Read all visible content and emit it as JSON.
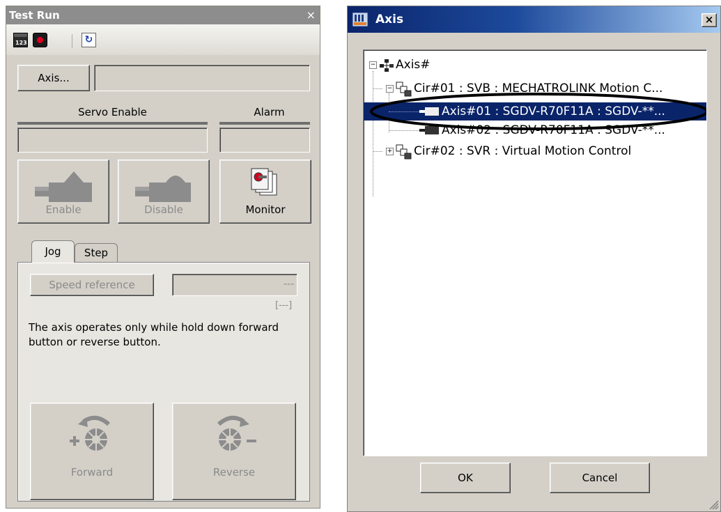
{
  "test_run": {
    "title": "Test Run",
    "close_glyph": "×",
    "toolbar": {
      "calendar_icon_text": "123",
      "icons": [
        "calendar-icon",
        "record-icon",
        "refresh-icon"
      ]
    },
    "axis_button_label": "Axis...",
    "axis_value": "",
    "servo_enable_label": "Servo Enable",
    "alarm_label": "Alarm",
    "enable_label": "Enable",
    "disable_label": "Disable",
    "monitor_label": "Monitor",
    "tabs": [
      {
        "label": "Jog",
        "active": true
      },
      {
        "label": "Step",
        "active": false
      }
    ],
    "jog": {
      "speed_reference_label": "Speed reference",
      "speed_value": "---",
      "unit_label": "[---]",
      "info_text": "The axis operates only while hold down forward button or reverse button.",
      "forward_label": "Forward",
      "reverse_label": "Reverse"
    }
  },
  "axis_dialog": {
    "title": "Axis",
    "close_glyph": "×",
    "tree": {
      "root": "Axis#",
      "circuits": [
        {
          "label": "Cir#01 : SVB : MECHATROLINK Motion C...",
          "expanded": true,
          "children": [
            {
              "label": "Axis#01 : SGDV-R70F11A : SGDV-**...",
              "selected": true
            },
            {
              "label": "Axis#02 : SGDV-R70F11A : SGDV-**...",
              "selected": false
            }
          ]
        },
        {
          "label": "Cir#02 : SVR : Virtual Motion Control",
          "expanded": false,
          "children": []
        }
      ]
    },
    "ok_label": "OK",
    "cancel_label": "Cancel"
  },
  "colors": {
    "window_bg": "#d4d0c8",
    "title_grey": "#8d8d8d",
    "title_blue": "#0a246a",
    "selection": "#0a246a",
    "highlight_ellipse": "#000000"
  }
}
